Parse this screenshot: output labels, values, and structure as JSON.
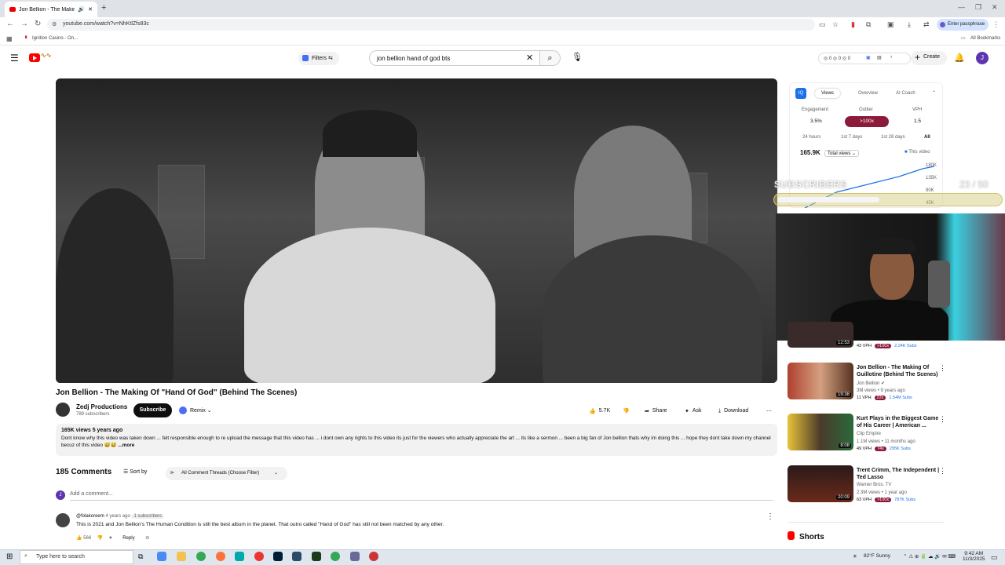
{
  "browser": {
    "tab_title": "Jon Bellion - The Making O",
    "url": "youtube.com/watch?v=NhKtlZfs83c",
    "passphrase_label": "Enter passphrase",
    "bookmark": "Ignition Casino - On...",
    "all_bookmarks": "All Bookmarks"
  },
  "header": {
    "filters_label": "Filters",
    "search_value": "jon bellion hand of god bts",
    "counters": "◎ 0  ◎ 0  ◎ 0",
    "create_label": "Create",
    "avatar_letter": "J"
  },
  "video": {
    "title": "Jon Bellion - The Making Of \"Hand Of God\" (Behind The Scenes)",
    "channel": "Zedj Productions",
    "subscribers": "789 subscribers",
    "subscribe_label": "Subscribe",
    "remix_label": "Remix",
    "likes": "5.7K",
    "share_label": "Share",
    "ask_label": "Ask",
    "download_label": "Download",
    "desc_meta": "165K views  5 years ago",
    "desc_text": "Dont know why this video was taken down ... felt responsible  enough to re upload the message that this video has  ... i dont own any rights to this video its just for the viewers  who actually appreciate  the art ... its like a sermon ... been a big fan of Jon bellion  thats why im doing this ... hope they dont take down my channel becuz of this video 😅😅",
    "more_label": "...more"
  },
  "comments": {
    "count_label": "185 Comments",
    "sort_label": "Sort by",
    "filter_label": "All Comment Threads (Choose Filter)",
    "add_placeholder": "Add a comment...",
    "my_avatar": "J",
    "first": {
      "author": "@folakoreem",
      "age": "4 years ago",
      "badge": "1 subscribers",
      "text": "This is 2021 and Jon Bellion's The Human Condition is still the best album in the planet. That outro called \"Hand of God\" has still not been matched by any other.",
      "likes": "566",
      "reply_label": "Reply"
    }
  },
  "extension": {
    "tabs": [
      "Views",
      "Overview",
      "AI Coach"
    ],
    "engagement_label": "Engagement",
    "outlier_label": "Outlier",
    "vph_label": "VPH",
    "engagement": "3.5%",
    "outlier": ">100x",
    "vph": "1.5",
    "ranges": [
      "24 hours",
      "1st 7 days",
      "1st 28 days",
      "All"
    ],
    "total_views": "165.9K",
    "total_select": "Total views",
    "legend": "This video",
    "y_ticks": [
      "180K",
      "135K",
      "90K",
      "45K"
    ]
  },
  "overlay": {
    "subs_label": "SUBSCRIBERS",
    "subs_count": "23  / 50",
    "progress": 0.46
  },
  "recommendations": [
    {
      "duration": "12:53",
      "title": "",
      "channel": "",
      "meta": "",
      "vph": "43 VPH",
      "outlier": ">100x",
      "subs": "2.24K Subs"
    },
    {
      "duration": "19:38",
      "title": "Jon Bellion - The Making Of Guillotine (Behind The Scenes)",
      "channel": "Jon Bellion",
      "meta": "3M views • 9 years ago",
      "vph": "11 VPH",
      "outlier": "22x",
      "subs": "1.54M Subs"
    },
    {
      "duration": "8:08",
      "title": "Kurt Plays in the Biggest Game of His Career | American ...",
      "channel": "Clip Empire",
      "meta": "1.1M views • 11 months ago",
      "vph": "49 VPH",
      "outlier": "74x",
      "subs": "295K Subs"
    },
    {
      "duration": "20:09",
      "title": "Trent Crimm, The Independent | Ted Lasso",
      "channel": "Warner Bros. TV",
      "meta": "2.3M views • 1 year ago",
      "vph": "63 VPH",
      "outlier": ">100x",
      "subs": "787K Subs"
    }
  ],
  "shorts_label": "Shorts",
  "taskbar": {
    "search_placeholder": "Type here to search",
    "weather": "82°F  Sunny",
    "time": "9:42 AM",
    "date": "11/3/2025"
  }
}
